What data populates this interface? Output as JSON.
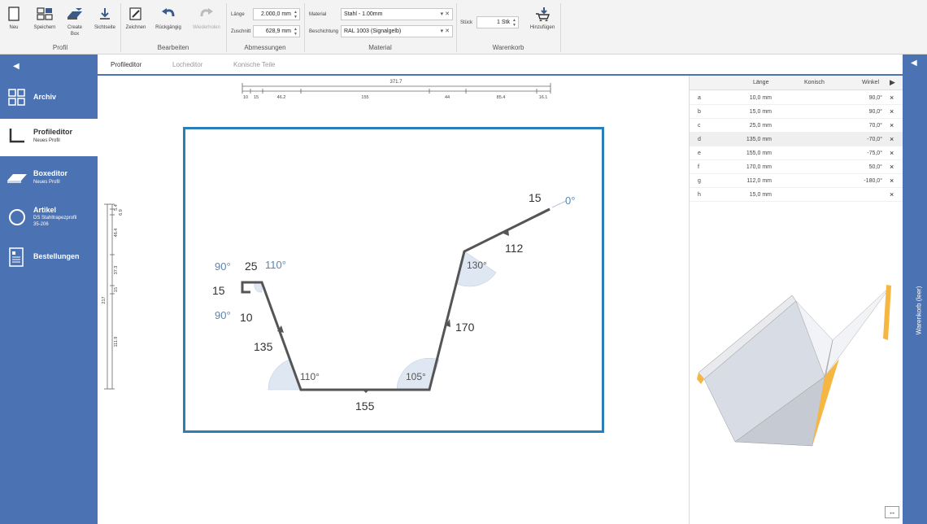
{
  "ribbon": {
    "buttons": {
      "neu": "Neu",
      "speichern": "Speichern",
      "create_box_1": "Create",
      "create_box_2": "Box",
      "sichtseite": "Sichtseite",
      "zeichnen": "Zeichnen",
      "rueckgaengig": "Rückgängig",
      "wiederholen": "Wiederholen",
      "hinzufuegen": "Hinzufügen"
    },
    "groups": {
      "profil": "Profil",
      "bearbeiten": "Bearbeiten",
      "abmessungen": "Abmessungen",
      "material": "Material",
      "warenkorb": "Warenkorb"
    },
    "fields": {
      "laenge_label": "Länge",
      "laenge_value": "2.000,0 mm",
      "zuschnitt_label": "Zuschnitt",
      "zuschnitt_value": "628,9 mm",
      "material_label": "Material",
      "material_value": "Stahl - 1.00mm",
      "beschichtung_label": "Beschichtung",
      "beschichtung_value": "RAL 1003 (Signalgelb)",
      "stueck_label": "Stück",
      "stueck_value": "1 Stk"
    }
  },
  "sidebar": {
    "archiv": {
      "title": "Archiv"
    },
    "profileditor": {
      "title": "Profileditor",
      "sub": "Neues Profil"
    },
    "boxeditor": {
      "title": "Boxeditor",
      "sub": "Neues Profil"
    },
    "artikel": {
      "title": "Artikel",
      "sub1": "DS Stahltrapezprofil",
      "sub2": "35-206"
    },
    "bestellungen": {
      "title": "Bestellungen"
    }
  },
  "tabs": [
    "Profileditor",
    "Locheditor",
    "Konische Teile"
  ],
  "ruler_top": {
    "total": "371.7",
    "segments": [
      "10",
      "15",
      "46.2",
      "155",
      "44",
      "85.4",
      "16.1"
    ]
  },
  "ruler_left": {
    "total": "217",
    "segments": [
      "5.4",
      "6.9",
      "46.4",
      "37.3",
      "15",
      "111.9"
    ]
  },
  "drawing": {
    "seg_15_left": "15",
    "seg_25": "25",
    "seg_10": "10",
    "seg_135": "135",
    "seg_155": "155",
    "seg_170": "170",
    "seg_112": "112",
    "seg_15_right": "15",
    "ang_90_top": "90°",
    "ang_90_bottom": "90°",
    "ang_110_top": "110°",
    "ang_110_bottom": "110°",
    "ang_105": "105°",
    "ang_130": "130°",
    "ang_0": "0°"
  },
  "table": {
    "headers": {
      "laenge": "Länge",
      "konisch": "Konisch",
      "winkel": "Winkel"
    },
    "rows": [
      {
        "id": "a",
        "laenge": "10,0 mm",
        "winkel": "90,0°"
      },
      {
        "id": "b",
        "laenge": "15,0 mm",
        "winkel": "90,0°"
      },
      {
        "id": "c",
        "laenge": "25,0 mm",
        "winkel": "70,0°"
      },
      {
        "id": "d",
        "laenge": "135,0 mm",
        "winkel": "-70,0°"
      },
      {
        "id": "e",
        "laenge": "155,0 mm",
        "winkel": "-75,0°"
      },
      {
        "id": "f",
        "laenge": "170,0 mm",
        "winkel": "50,0°"
      },
      {
        "id": "g",
        "laenge": "112,0 mm",
        "winkel": "-180,0°"
      },
      {
        "id": "h",
        "laenge": "15,0 mm",
        "winkel": ""
      }
    ],
    "delete_glyph": "×",
    "expand_glyph": "↔"
  },
  "warenkorb_sidebar": {
    "label": "Warenkorb (leer)"
  },
  "colors": {
    "accent": "#4b73b3",
    "frame": "#2a7fb8",
    "profile_yellow": "#f5b642"
  }
}
